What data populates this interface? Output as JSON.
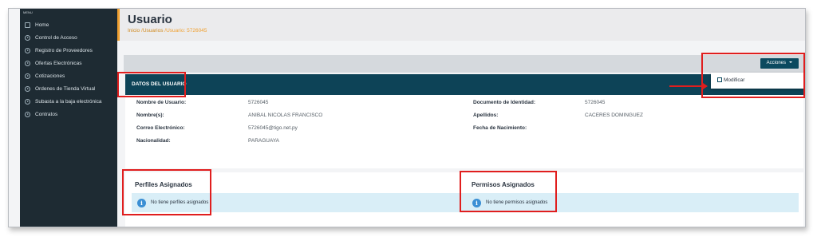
{
  "sidebar": {
    "header": "MENU",
    "items": [
      {
        "label": "Home",
        "icon": "home-icon"
      },
      {
        "label": "Control de Acceso",
        "icon": "chevron-right-icon"
      },
      {
        "label": "Registro de Proveedores",
        "icon": "chevron-right-icon"
      },
      {
        "label": "Ofertas Electrónicas",
        "icon": "chevron-right-icon"
      },
      {
        "label": "Cotizaciones",
        "icon": "chevron-right-icon"
      },
      {
        "label": "Ordenes de Tienda Virtual",
        "icon": "chevron-right-icon"
      },
      {
        "label": "Subasta a la baja electrónica",
        "icon": "chevron-right-icon"
      },
      {
        "label": "Contratos",
        "icon": "chevron-right-icon"
      }
    ]
  },
  "header": {
    "title": "Usuario",
    "breadcrumb": {
      "inicio": "Inicio",
      "sep1": " /",
      "usuarios": "Usuarios",
      "sep2": " /",
      "current": "Usuario: 5726045"
    }
  },
  "toolbar": {
    "acciones_label": "Acciones",
    "dropdown_item": "Modificar"
  },
  "user": {
    "section_title": "DATOS DEL USUARIO",
    "fields": {
      "nombre_usuario_label": "Nombre de Usuario:",
      "nombre_usuario_value": "5726045",
      "nombres_label": "Nombre(s):",
      "nombres_value": "ANIBAL NICOLAS FRANCISCO",
      "correo_label": "Correo Electrónico:",
      "correo_value": "5726045@tigo.net.py",
      "nacionalidad_label": "Nacionalidad:",
      "nacionalidad_value": "PARAGUAYA",
      "documento_label": "Documento de Identidad:",
      "documento_value": "5726045",
      "apellidos_label": "Apellidos:",
      "apellidos_value": "CACERES DOMINGUEZ",
      "nacimiento_label": "Fecha de Nacimiento:"
    }
  },
  "perfiles": {
    "title": "Perfiles Asignados",
    "message": "No tiene perfiles asignados"
  },
  "permisos": {
    "title": "Permisos Asignados",
    "message": "No tiene permisos asignados"
  },
  "colors": {
    "sidebar": "#1e2b33",
    "header_bar": "#0d4357",
    "accent": "#f0a030",
    "annotation": "#e01e1e",
    "alert_bg": "#d9eef7"
  }
}
